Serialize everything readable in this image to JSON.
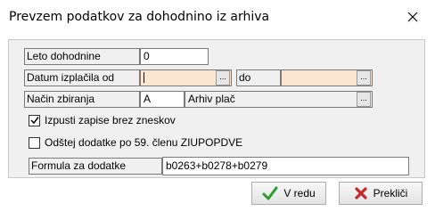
{
  "dialog": {
    "title": "Prevzem podatkov za dohodnino iz arhiva"
  },
  "form": {
    "year_label": "Leto dohodnine",
    "year_value": "0",
    "date_from_label": "Datum izplačila od",
    "date_from_value": "",
    "date_to_label": "do",
    "date_to_value": "",
    "ellipsis": "...",
    "collect_label": "Način zbiranja",
    "collect_code": "A",
    "collect_value": "Arhiv plač",
    "skip_zero_label": "Izpusti zapise brez zneskov",
    "skip_zero_checked": true,
    "deduct_label": "Odštej dodatke po 59. členu ZIUPOPDVE",
    "deduct_checked": false,
    "formula_label": "Formula za dodatke",
    "formula_value": "b0263+b0278+b0279"
  },
  "buttons": {
    "ok_label": "V redu",
    "cancel_label": "Prekliči"
  },
  "colors": {
    "date_field_bg": "#fde6cf",
    "ok_icon": "#2a9d2a",
    "cancel_icon": "#c62828"
  }
}
